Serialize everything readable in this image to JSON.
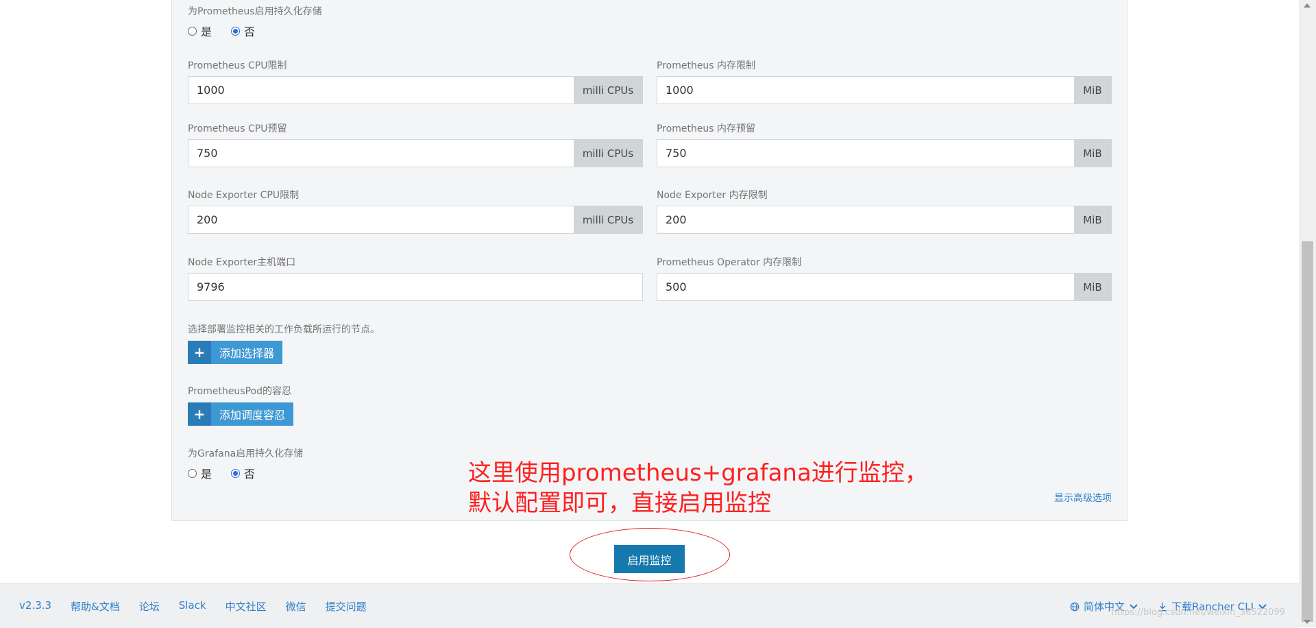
{
  "form": {
    "prometheus_persist": {
      "label": "为Prometheus启用持久化存储",
      "options": [
        "是",
        "否"
      ],
      "selected": "否"
    },
    "prometheus_cpu_limit": {
      "label": "Prometheus CPU限制",
      "value": "1000",
      "unit": "milli CPUs"
    },
    "prometheus_mem_limit": {
      "label": "Prometheus 内存限制",
      "value": "1000",
      "unit": "MiB"
    },
    "prometheus_cpu_reserve": {
      "label": "Prometheus CPU预留",
      "value": "750",
      "unit": "milli CPUs"
    },
    "prometheus_mem_reserve": {
      "label": "Prometheus 内存预留",
      "value": "750",
      "unit": "MiB"
    },
    "node_exporter_cpu_limit": {
      "label": "Node Exporter CPU限制",
      "value": "200",
      "unit": "milli CPUs"
    },
    "node_exporter_mem_limit": {
      "label": "Node Exporter 内存限制",
      "value": "200",
      "unit": "MiB"
    },
    "node_exporter_host_port": {
      "label": "Node Exporter主机端口",
      "value": "9796"
    },
    "operator_mem_limit": {
      "label": "Prometheus Operator 内存限制",
      "value": "500",
      "unit": "MiB"
    },
    "node_selector": {
      "label": "选择部署监控相关的工作负载所运行的节点。",
      "button": "添加选择器"
    },
    "tolerations": {
      "label": "PrometheusPod的容忍",
      "button": "添加调度容忍"
    },
    "grafana_persist": {
      "label": "为Grafana启用持久化存储",
      "options": [
        "是",
        "否"
      ],
      "selected": "否"
    },
    "advanced_link": "显示高级选项"
  },
  "annotation": {
    "line1": "这里使用prometheus+grafana进行监控，",
    "line2": "默认配置即可，直接启用监控"
  },
  "primary_button": "启用监控",
  "footer": {
    "version": "v2.3.3",
    "links": [
      "帮助&文档",
      "论坛",
      "Slack",
      "中文社区",
      "微信",
      "提交问题"
    ],
    "language": "简体中文",
    "download": "下载Rancher CLI",
    "watermark": "https://blog.csdn.net/weixin_36522099"
  },
  "colors": {
    "accent": "#1679ae",
    "link": "#2f7ecb",
    "annotation": "#ff1f1f"
  }
}
